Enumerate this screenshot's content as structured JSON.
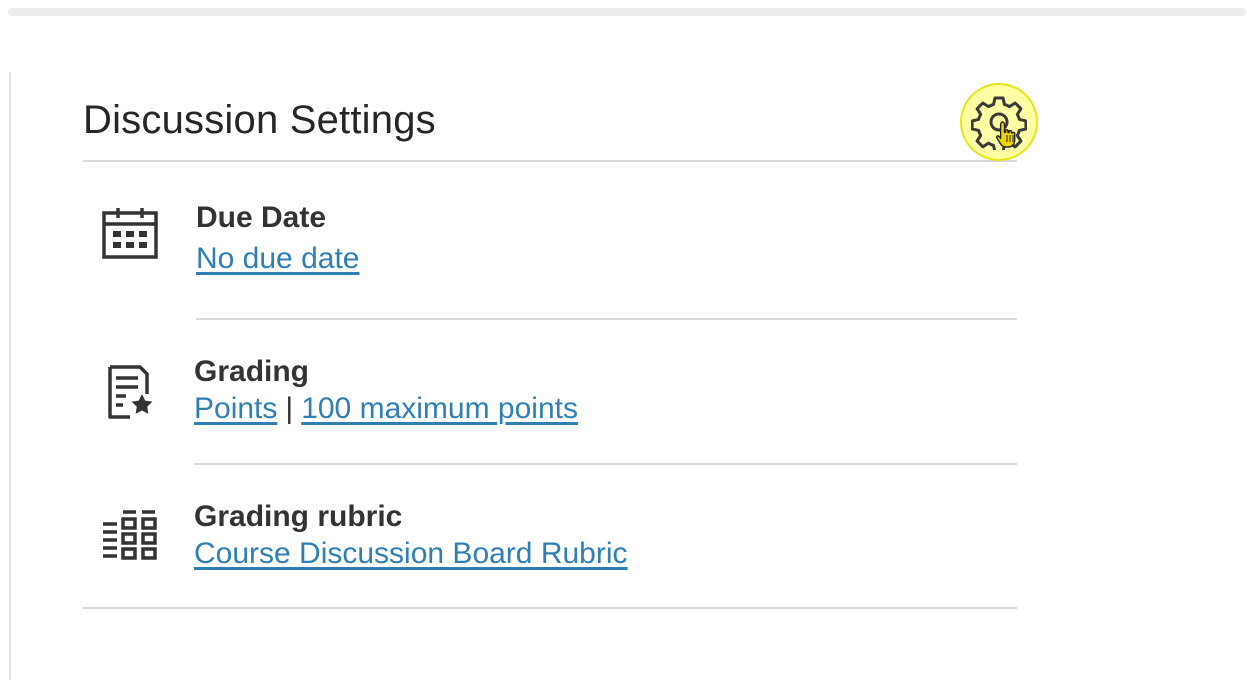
{
  "panel": {
    "title": "Discussion Settings",
    "settings_icon": "gear-icon"
  },
  "settings": [
    {
      "icon": "calendar-icon",
      "label": "Due Date",
      "link": "No due date"
    },
    {
      "icon": "grading-star-icon",
      "label": "Grading",
      "link_scheme": "Points",
      "separator": "|",
      "link_points": "100 maximum points"
    },
    {
      "icon": "rubric-grid-icon",
      "label": "Grading rubric",
      "link": "Course Discussion Board Rubric"
    }
  ],
  "colors": {
    "link": "#2f7fb5",
    "text": "#333333",
    "highlight": "#ffff5a",
    "divider": "#d9d9d9"
  }
}
